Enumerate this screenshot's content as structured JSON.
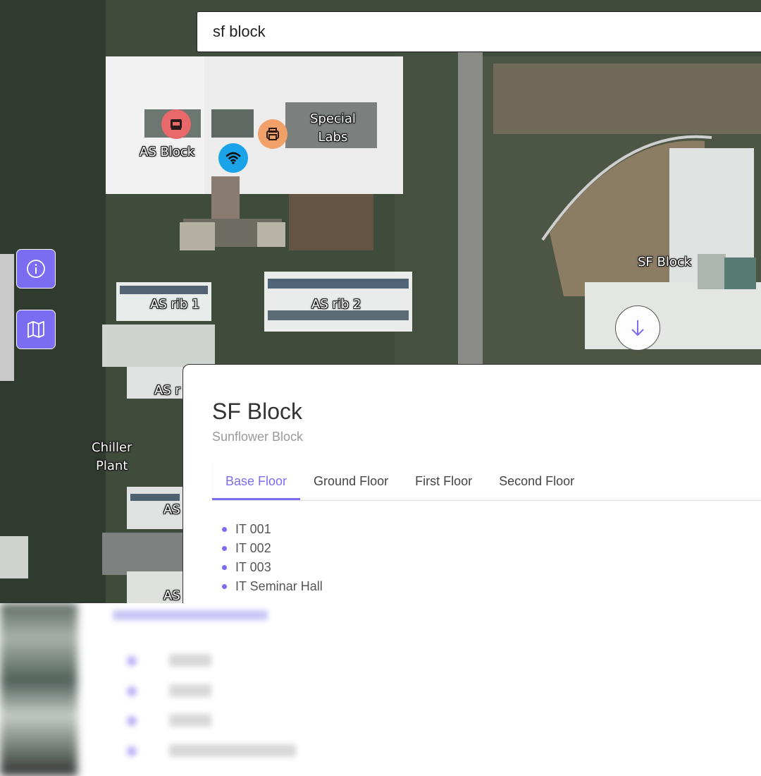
{
  "search": {
    "value": "sf block"
  },
  "map": {
    "labels": {
      "as_block": "AS Block",
      "special_labs": "Special\nLabs",
      "sf_block": "SF Block",
      "as_rib_1": "AS rib 1",
      "as_rib_2": "AS rib 2",
      "as_partial_1": "AS r",
      "as_partial_2": "AS",
      "as_partial_3": "AS",
      "chiller_plant": "Chiller\nPlant"
    },
    "poi_colors": {
      "food": "#e9686a",
      "print": "#f2a06a",
      "wifi": "#1aa3e8"
    }
  },
  "controls": {
    "info_icon": "info-icon",
    "map_icon": "map-icon",
    "scroll_icon": "arrow-down-icon",
    "accent": "#7b6cf2"
  },
  "panel": {
    "title": "SF Block",
    "subtitle": "Sunflower Block",
    "tabs": [
      "Base Floor",
      "Ground Floor",
      "First Floor",
      "Second Floor"
    ],
    "active_tab": "Base Floor",
    "rooms": [
      "IT 001",
      "IT 002",
      "IT 003",
      "IT Seminar Hall"
    ]
  }
}
